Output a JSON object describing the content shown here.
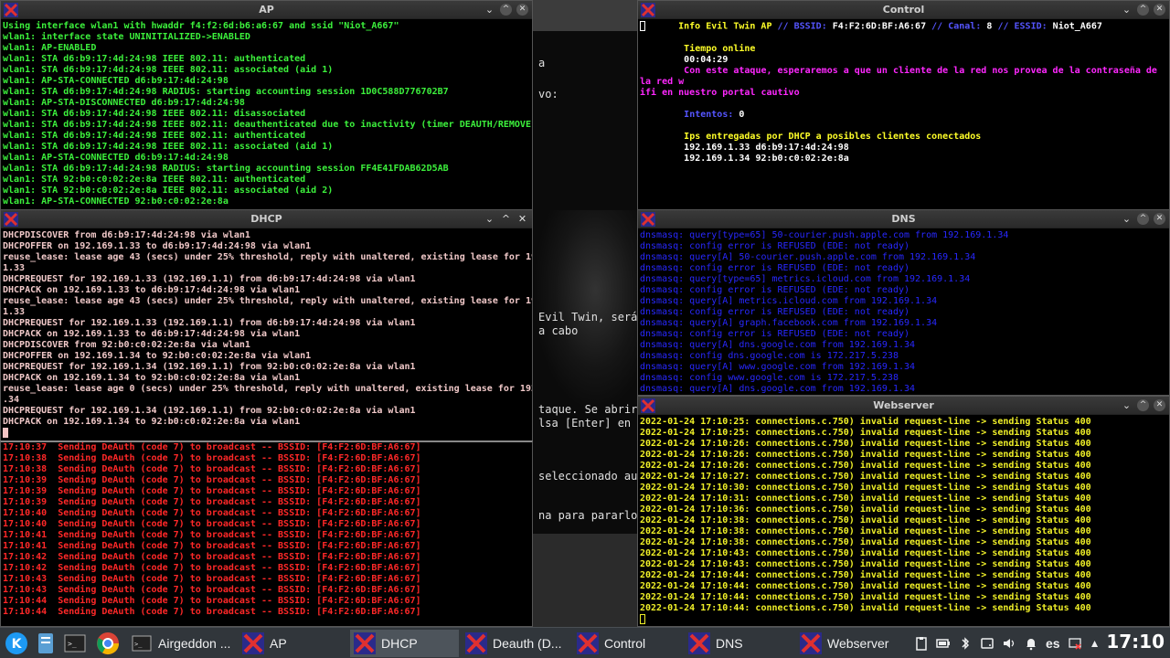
{
  "bg_terminal": {
    "lines": [
      "a",
      "vo:",
      "Evil Twin, será",
      "a cabo",
      "taque. Se abrirá",
      "lsa [Enter] en e",
      "seleccionado aut",
      "na para pararlo"
    ]
  },
  "ap": {
    "title": "AP",
    "lines": [
      "Using interface wlan1 with hwaddr f4:f2:6d:b6:a6:67 and ssid \"Niot_A667\"",
      "wlan1: interface state UNINITIALIZED->ENABLED",
      "wlan1: AP-ENABLED",
      "wlan1: STA d6:b9:17:4d:24:98 IEEE 802.11: authenticated",
      "wlan1: STA d6:b9:17:4d:24:98 IEEE 802.11: associated (aid 1)",
      "wlan1: AP-STA-CONNECTED d6:b9:17:4d:24:98",
      "wlan1: STA d6:b9:17:4d:24:98 RADIUS: starting accounting session 1D0C588D776702B7",
      "wlan1: AP-STA-DISCONNECTED d6:b9:17:4d:24:98",
      "wlan1: STA d6:b9:17:4d:24:98 IEEE 802.11: disassociated",
      "wlan1: STA d6:b9:17:4d:24:98 IEEE 802.11: deauthenticated due to inactivity (timer DEAUTH/REMOVE)",
      "wlan1: STA d6:b9:17:4d:24:98 IEEE 802.11: authenticated",
      "wlan1: STA d6:b9:17:4d:24:98 IEEE 802.11: associated (aid 1)",
      "wlan1: AP-STA-CONNECTED d6:b9:17:4d:24:98",
      "wlan1: STA d6:b9:17:4d:24:98 RADIUS: starting accounting session FF4E41FDAB62D5AB",
      "wlan1: STA 92:b0:c0:02:2e:8a IEEE 802.11: authenticated",
      "wlan1: STA 92:b0:c0:02:2e:8a IEEE 802.11: associated (aid 2)",
      "wlan1: AP-STA-CONNECTED 92:b0:c0:02:2e:8a"
    ]
  },
  "dhcp": {
    "title": "DHCP",
    "lines": [
      "DHCPDISCOVER from d6:b9:17:4d:24:98 via wlan1",
      "DHCPOFFER on 192.169.1.33 to d6:b9:17:4d:24:98 via wlan1",
      "reuse_lease: lease age 43 (secs) under 25% threshold, reply with unaltered, existing lease for 192.169.",
      "1.33",
      "DHCPREQUEST for 192.169.1.33 (192.169.1.1) from d6:b9:17:4d:24:98 via wlan1",
      "DHCPACK on 192.169.1.33 to d6:b9:17:4d:24:98 via wlan1",
      "reuse_lease: lease age 43 (secs) under 25% threshold, reply with unaltered, existing lease for 192.169.",
      "1.33",
      "DHCPREQUEST for 192.169.1.33 (192.169.1.1) from d6:b9:17:4d:24:98 via wlan1",
      "DHCPACK on 192.169.1.33 to d6:b9:17:4d:24:98 via wlan1",
      "DHCPDISCOVER from 92:b0:c0:02:2e:8a via wlan1",
      "DHCPOFFER on 192.169.1.34 to 92:b0:c0:02:2e:8a via wlan1",
      "DHCPREQUEST for 192.169.1.34 (192.169.1.1) from 92:b0:c0:02:2e:8a via wlan1",
      "DHCPACK on 192.169.1.34 to 92:b0:c0:02:2e:8a via wlan1",
      "reuse_lease: lease age 0 (secs) under 25% threshold, reply with unaltered, existing lease for 192.169.1",
      ".34",
      "DHCPREQUEST for 192.169.1.34 (192.169.1.1) from 92:b0:c0:02:2e:8a via wlan1",
      "DHCPACK on 192.169.1.34 to 92:b0:c0:02:2e:8a via wlan1"
    ]
  },
  "deauth": {
    "lines": [
      "17:10:37  Sending DeAuth (code 7) to broadcast -- BSSID: [F4:F2:6D:BF:A6:67]",
      "17:10:38  Sending DeAuth (code 7) to broadcast -- BSSID: [F4:F2:6D:BF:A6:67]",
      "17:10:38  Sending DeAuth (code 7) to broadcast -- BSSID: [F4:F2:6D:BF:A6:67]",
      "17:10:39  Sending DeAuth (code 7) to broadcast -- BSSID: [F4:F2:6D:BF:A6:67]",
      "17:10:39  Sending DeAuth (code 7) to broadcast -- BSSID: [F4:F2:6D:BF:A6:67]",
      "17:10:39  Sending DeAuth (code 7) to broadcast -- BSSID: [F4:F2:6D:BF:A6:67]",
      "17:10:40  Sending DeAuth (code 7) to broadcast -- BSSID: [F4:F2:6D:BF:A6:67]",
      "17:10:40  Sending DeAuth (code 7) to broadcast -- BSSID: [F4:F2:6D:BF:A6:67]",
      "17:10:41  Sending DeAuth (code 7) to broadcast -- BSSID: [F4:F2:6D:BF:A6:67]",
      "17:10:41  Sending DeAuth (code 7) to broadcast -- BSSID: [F4:F2:6D:BF:A6:67]",
      "17:10:42  Sending DeAuth (code 7) to broadcast -- BSSID: [F4:F2:6D:BF:A6:67]",
      "17:10:42  Sending DeAuth (code 7) to broadcast -- BSSID: [F4:F2:6D:BF:A6:67]",
      "17:10:43  Sending DeAuth (code 7) to broadcast -- BSSID: [F4:F2:6D:BF:A6:67]",
      "17:10:43  Sending DeAuth (code 7) to broadcast -- BSSID: [F4:F2:6D:BF:A6:67]",
      "17:10:44  Sending DeAuth (code 7) to broadcast -- BSSID: [F4:F2:6D:BF:A6:67]",
      "17:10:44  Sending DeAuth (code 7) to broadcast -- BSSID: [F4:F2:6D:BF:A6:67]"
    ]
  },
  "control": {
    "title": "Control",
    "info_label": "Info Evil Twin AP",
    "sep": "//",
    "bssid_label": "BSSID:",
    "bssid": "F4:F2:6D:BF:A6:67",
    "canal_label": "Canal:",
    "canal": "8",
    "essid_label": "ESSID:",
    "essid": "Niot_A667",
    "online_label": "Tiempo online",
    "online_value": "00:04:29",
    "message_a": "Con este ataque, esperaremos a que un cliente de la red nos provea de la contraseña de la red w",
    "message_b": "ifi en nuestro portal cautivo",
    "attempts_label": "Intentos:",
    "attempts_value": "0",
    "ips_label": "Ips entregadas por DHCP a posibles clientes conectados",
    "ips": [
      "192.169.1.33 d6:b9:17:4d:24:98",
      "192.169.1.34 92:b0:c0:02:2e:8a"
    ]
  },
  "dns": {
    "title": "DNS",
    "lines": [
      "dnsmasq: query[type=65] 50-courier.push.apple.com from 192.169.1.34",
      "dnsmasq: config error is REFUSED (EDE: not ready)",
      "dnsmasq: query[A] 50-courier.push.apple.com from 192.169.1.34",
      "dnsmasq: config error is REFUSED (EDE: not ready)",
      "dnsmasq: query[type=65] metrics.icloud.com from 192.169.1.34",
      "dnsmasq: config error is REFUSED (EDE: not ready)",
      "dnsmasq: query[A] metrics.icloud.com from 192.169.1.34",
      "dnsmasq: config error is REFUSED (EDE: not ready)",
      "dnsmasq: query[A] graph.facebook.com from 192.169.1.34",
      "dnsmasq: config error is REFUSED (EDE: not ready)",
      "dnsmasq: query[A] dns.google.com from 192.169.1.34",
      "dnsmasq: config dns.google.com is 172.217.5.238",
      "dnsmasq: query[A] www.google.com from 192.169.1.34",
      "dnsmasq: config www.google.com is 172.217.5.238",
      "dnsmasq: query[A] dns.google.com from 192.169.1.34"
    ]
  },
  "webserver": {
    "title": "Webserver",
    "lines": [
      "2022-01-24 17:10:25: connections.c.750) invalid request-line -> sending Status 400",
      "2022-01-24 17:10:25: connections.c.750) invalid request-line -> sending Status 400",
      "2022-01-24 17:10:26: connections.c.750) invalid request-line -> sending Status 400",
      "2022-01-24 17:10:26: connections.c.750) invalid request-line -> sending Status 400",
      "2022-01-24 17:10:26: connections.c.750) invalid request-line -> sending Status 400",
      "2022-01-24 17:10:27: connections.c.750) invalid request-line -> sending Status 400",
      "2022-01-24 17:10:30: connections.c.750) invalid request-line -> sending Status 400",
      "2022-01-24 17:10:31: connections.c.750) invalid request-line -> sending Status 400",
      "2022-01-24 17:10:36: connections.c.750) invalid request-line -> sending Status 400",
      "2022-01-24 17:10:38: connections.c.750) invalid request-line -> sending Status 400",
      "2022-01-24 17:10:38: connections.c.750) invalid request-line -> sending Status 400",
      "2022-01-24 17:10:38: connections.c.750) invalid request-line -> sending Status 400",
      "2022-01-24 17:10:43: connections.c.750) invalid request-line -> sending Status 400",
      "2022-01-24 17:10:43: connections.c.750) invalid request-line -> sending Status 400",
      "2022-01-24 17:10:44: connections.c.750) invalid request-line -> sending Status 400",
      "2022-01-24 17:10:44: connections.c.750) invalid request-line -> sending Status 400",
      "2022-01-24 17:10:44: connections.c.750) invalid request-line -> sending Status 400",
      "2022-01-24 17:10:44: connections.c.750) invalid request-line -> sending Status 400"
    ]
  },
  "taskbar": {
    "tasks": [
      "Airgeddon ...",
      "AP",
      "DHCP",
      "Deauth (D...",
      "Control",
      "DNS",
      "Webserver"
    ],
    "language": "es",
    "clock": "17:10"
  },
  "colors": {
    "green": "#3cf03c",
    "dhcp": "#f0c8c8",
    "red": "#ff2828",
    "blue": "#2828ff",
    "yellow": "#f0f028",
    "magenta": "#ff28ff",
    "taskbar": "#31363b"
  }
}
